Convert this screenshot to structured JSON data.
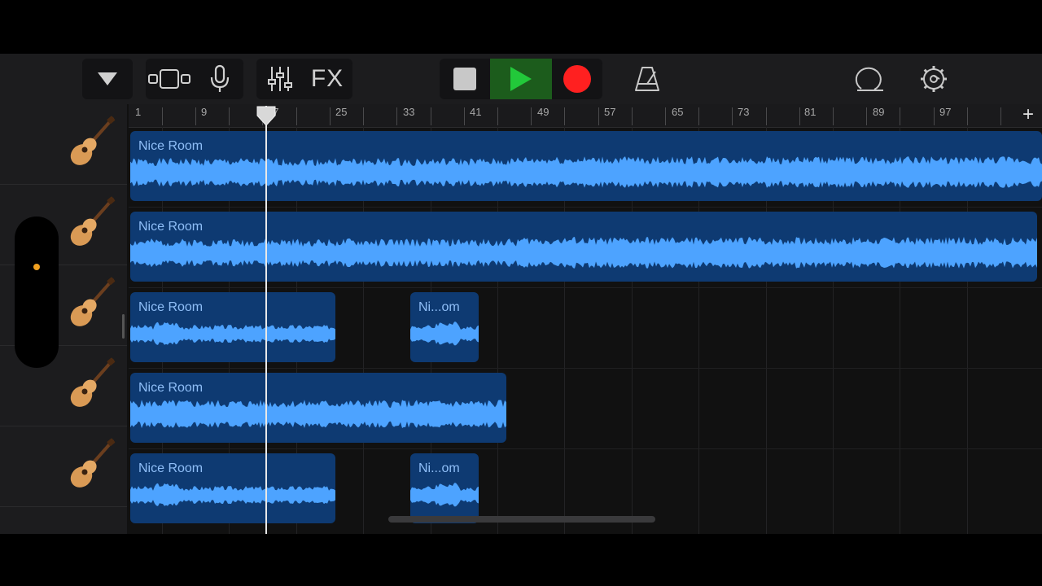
{
  "toolbar": {
    "fx_label": "FX",
    "buttons": [
      "tracks-dropdown",
      "view-toggle",
      "microphone",
      "mixer",
      "fx",
      "stop",
      "play",
      "record",
      "metronome",
      "loop-browser",
      "settings"
    ]
  },
  "ruler": {
    "bars": [
      "1",
      "9",
      "17",
      "25",
      "33",
      "41",
      "49",
      "57",
      "65",
      "73",
      "81",
      "89",
      "97"
    ],
    "add_label": "+"
  },
  "tracks": [
    {
      "instrument": "acoustic-guitar",
      "regions": [
        {
          "label": "Nice Room"
        }
      ]
    },
    {
      "instrument": "acoustic-guitar",
      "regions": [
        {
          "label": "Nice Room"
        }
      ]
    },
    {
      "instrument": "acoustic-guitar",
      "regions": [
        {
          "label": "Nice Room"
        },
        {
          "label": "Ni...om"
        }
      ]
    },
    {
      "instrument": "acoustic-guitar",
      "regions": [
        {
          "label": "Nice Room"
        }
      ]
    },
    {
      "instrument": "acoustic-guitar",
      "regions": [
        {
          "label": "Nice Room"
        },
        {
          "label": "Ni...om"
        }
      ]
    }
  ],
  "colors": {
    "region": "#0e3a72",
    "waveform": "#4da3ff",
    "play": "#22c83a",
    "record": "#ff2020",
    "side_dot": "#f0a020"
  }
}
